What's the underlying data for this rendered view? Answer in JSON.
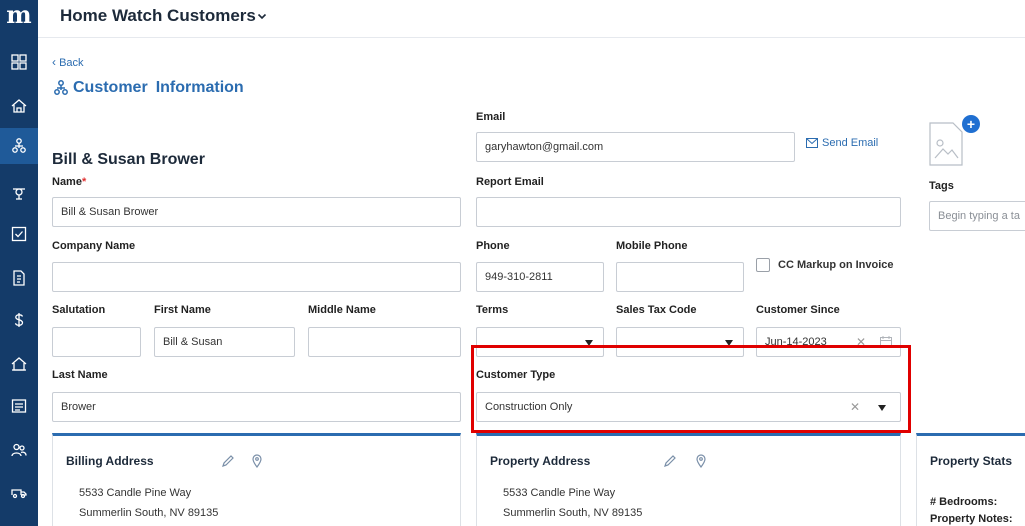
{
  "sidebar": {
    "logo": "m",
    "items": [
      {
        "icon": "grid-icon"
      },
      {
        "icon": "home-icon"
      },
      {
        "icon": "customers-icon",
        "active": true
      },
      {
        "icon": "technician-icon"
      },
      {
        "icon": "checkbox-icon"
      },
      {
        "icon": "invoice-icon"
      },
      {
        "icon": "dollar-icon"
      },
      {
        "icon": "property-icon"
      },
      {
        "icon": "list-icon"
      },
      {
        "icon": "team-icon"
      },
      {
        "icon": "vehicle-icon"
      }
    ]
  },
  "topbar": {
    "title": "Home Watch Customers"
  },
  "nav": {
    "back": "Back"
  },
  "page": {
    "title_part1": "Customer",
    "title_part2": "Information"
  },
  "customer": {
    "display_name": "Bill & Susan Brower"
  },
  "form": {
    "name": {
      "label": "Name",
      "required_mark": "*",
      "value": "Bill & Susan Brower"
    },
    "company": {
      "label": "Company Name",
      "value": ""
    },
    "salutation": {
      "label": "Salutation",
      "value": ""
    },
    "first_name": {
      "label": "First Name",
      "value": "Bill & Susan"
    },
    "middle_name": {
      "label": "Middle Name",
      "value": ""
    },
    "last_name": {
      "label": "Last Name",
      "value": "Brower"
    },
    "email": {
      "label": "Email",
      "value": "garyhawton@gmail.com",
      "send_label": "Send Email"
    },
    "report_email": {
      "label": "Report Email",
      "value": ""
    },
    "phone": {
      "label": "Phone",
      "value": "949-310-2811"
    },
    "mobile_phone": {
      "label": "Mobile Phone",
      "value": ""
    },
    "cc_markup": {
      "label": "CC Markup on Invoice",
      "checked": false
    },
    "terms": {
      "label": "Terms",
      "value": ""
    },
    "sales_tax": {
      "label": "Sales Tax Code",
      "value": ""
    },
    "customer_since": {
      "label": "Customer Since",
      "value": "Jun-14-2023"
    },
    "customer_type": {
      "label": "Customer Type",
      "value": "Construction Only"
    },
    "tags": {
      "label": "Tags",
      "placeholder": "Begin typing a ta"
    }
  },
  "billing": {
    "title": "Billing Address",
    "line1": "5533 Candle Pine Way",
    "line2": "Summerlin South, NV 89135"
  },
  "property_address": {
    "title": "Property Address",
    "line1": "5533 Candle Pine Way",
    "line2": "Summerlin South, NV 89135"
  },
  "property_stats": {
    "title": "Property Stats",
    "bedrooms_label": "# Bedrooms:",
    "notes_label": "Property Notes:"
  },
  "colors": {
    "sidebar": "#143b69",
    "accent": "#2b6cb0",
    "highlight": "#e00000"
  }
}
